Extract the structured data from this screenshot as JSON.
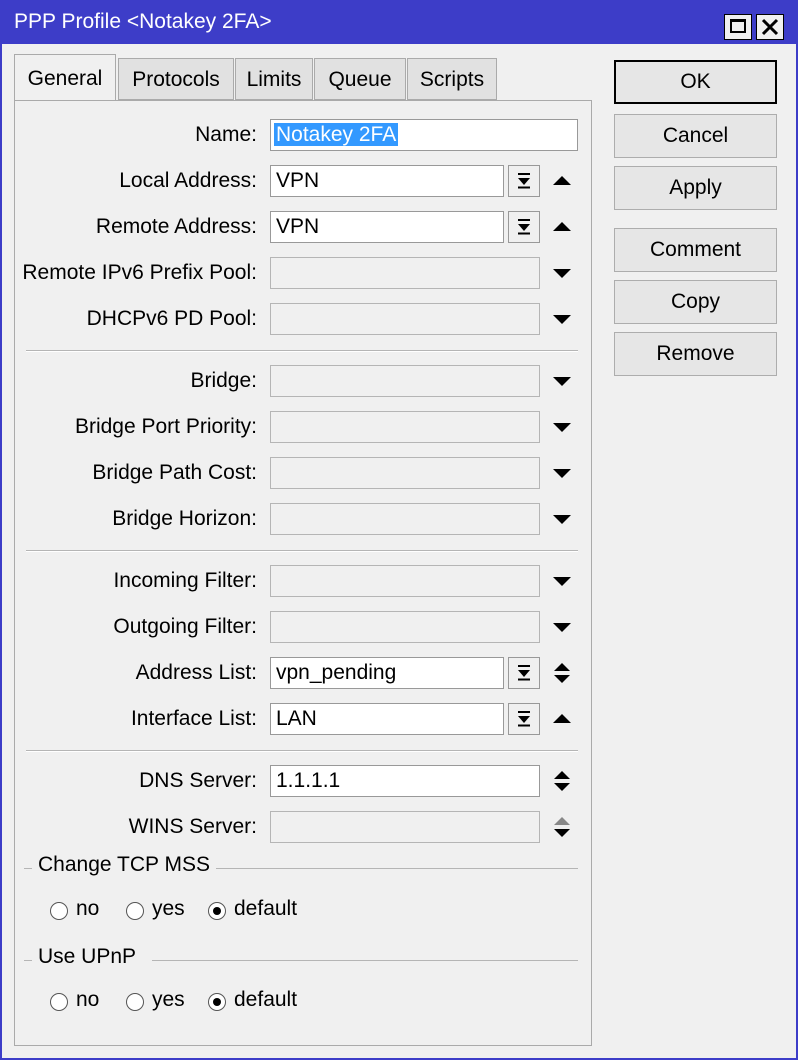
{
  "window": {
    "title": "PPP Profile <Notakey 2FA>",
    "controls": [
      "maximize-icon",
      "close-icon"
    ],
    "accent_color": "#3d3dc8"
  },
  "tabs": [
    {
      "label": "General",
      "active": true
    },
    {
      "label": "Protocols",
      "active": false
    },
    {
      "label": "Limits",
      "active": false
    },
    {
      "label": "Queue",
      "active": false
    },
    {
      "label": "Scripts",
      "active": false
    }
  ],
  "actions": {
    "ok": "OK",
    "cancel": "Cancel",
    "apply": "Apply",
    "comment": "Comment",
    "copy": "Copy",
    "remove": "Remove"
  },
  "fields": {
    "name": {
      "label": "Name:",
      "value": "Notakey 2FA"
    },
    "local_address": {
      "label": "Local Address:",
      "value": "VPN"
    },
    "remote_address": {
      "label": "Remote Address:",
      "value": "VPN"
    },
    "remote_ipv6_prefix_pool": {
      "label": "Remote IPv6 Prefix Pool:",
      "value": ""
    },
    "dhcpv6_pd_pool": {
      "label": "DHCPv6 PD Pool:",
      "value": ""
    },
    "bridge": {
      "label": "Bridge:",
      "value": ""
    },
    "bridge_port_priority": {
      "label": "Bridge Port Priority:",
      "value": ""
    },
    "bridge_path_cost": {
      "label": "Bridge Path Cost:",
      "value": ""
    },
    "bridge_horizon": {
      "label": "Bridge Horizon:",
      "value": ""
    },
    "incoming_filter": {
      "label": "Incoming Filter:",
      "value": ""
    },
    "outgoing_filter": {
      "label": "Outgoing Filter:",
      "value": ""
    },
    "address_list": {
      "label": "Address List:",
      "value": "vpn_pending"
    },
    "interface_list": {
      "label": "Interface List:",
      "value": "LAN"
    },
    "dns_server": {
      "label": "DNS Server:",
      "value": "1.1.1.1"
    },
    "wins_server": {
      "label": "WINS Server:",
      "value": ""
    }
  },
  "change_tcp_mss": {
    "title": "Change TCP MSS",
    "options": [
      "no",
      "yes",
      "default"
    ],
    "selected": "default"
  },
  "use_upnp": {
    "title": "Use UPnP",
    "options": [
      "no",
      "yes",
      "default"
    ],
    "selected": "default"
  }
}
